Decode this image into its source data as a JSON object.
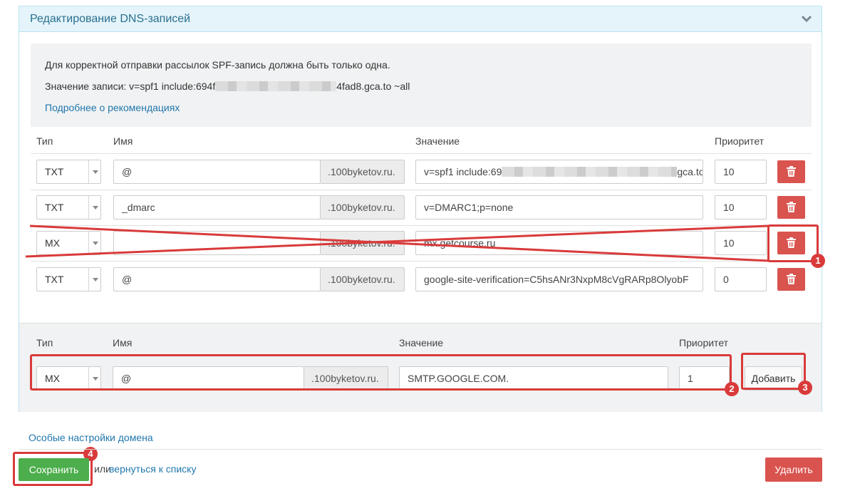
{
  "panel": {
    "title": "Редактирование DNS-записей",
    "collapse_icon": "chevron-down-icon"
  },
  "info": {
    "line1": "Для корректной отправки рассылок SPF-запись должна быть только одна.",
    "line2_prefix": "Значение записи: v=spf1 include:694f",
    "line2_suffix": "4fad8.gca.to ~all",
    "link": "Подробнее о рекомендациях"
  },
  "table": {
    "headers": {
      "type": "Тип",
      "name": "Имя",
      "value": "Значение",
      "priority": "Приоритет"
    },
    "rows": [
      {
        "type": "TXT",
        "name": "@",
        "domain": ".100byketov.ru.",
        "value_prefix": "v=spf1 include:69",
        "value_suffix": "gca.to",
        "priority": "10",
        "struck": false
      },
      {
        "type": "TXT",
        "name": "_dmarc",
        "domain": ".100byketov.ru.",
        "value": "v=DMARC1;p=none",
        "priority": "10",
        "struck": false
      },
      {
        "type": "MX",
        "name": "",
        "domain": ".100byketov.ru.",
        "value": "mx.getcourse.ru",
        "priority": "10",
        "struck": true
      },
      {
        "type": "TXT",
        "name": "@",
        "domain": ".100byketov.ru.",
        "value": "google-site-verification=C5hsANr3NxpM8cVgRARp8OlyobF",
        "priority": "0",
        "struck": false
      }
    ],
    "delete_icon": "trash-icon"
  },
  "add_form": {
    "headers": {
      "type": "Тип",
      "name": "Имя",
      "value": "Значение",
      "priority": "Приоритет"
    },
    "type": "MX",
    "name": "@",
    "domain": ".100byketov.ru.",
    "value": "SMTP.GOOGLE.COM.",
    "priority": "1",
    "add_label": "Добавить"
  },
  "annotations": [
    "1",
    "2",
    "3",
    "4"
  ],
  "annotation_color": "#d93a3a",
  "footer": {
    "special_settings": "Особые настройки домена",
    "save_label": "Сохранить",
    "or_text": "или",
    "back_link": "вернуться к списку",
    "delete_label": "Удалить"
  },
  "colors": {
    "link": "#2177ad",
    "save": "#4cae4c",
    "danger": "#d9534f",
    "header_bg": "#e4f4fa"
  }
}
